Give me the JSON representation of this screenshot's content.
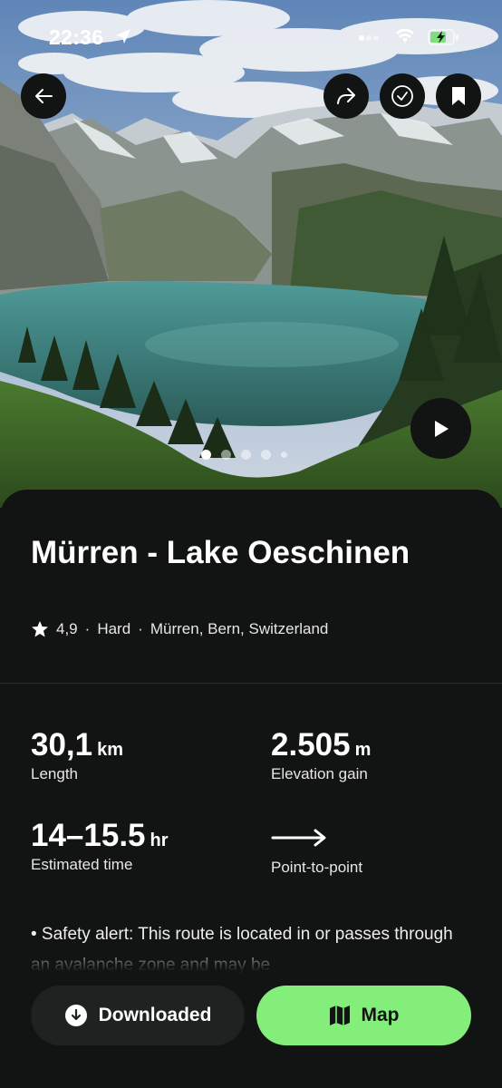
{
  "status_bar": {
    "time": "22:36",
    "icons": [
      "location-arrow-icon",
      "cellular-icon",
      "wifi-icon",
      "battery-charging-icon"
    ]
  },
  "hero": {
    "image": "mountain-lake-photo",
    "pages": 5,
    "active_page": 1,
    "actions": [
      "back-icon",
      "share-icon",
      "check-icon",
      "bookmark-icon",
      "play-icon"
    ]
  },
  "trail": {
    "title": "Mürren - Lake Oeschinen",
    "rating": "4,9",
    "difficulty": "Hard",
    "location": "Mürren, Bern, Switzerland",
    "separator": "·"
  },
  "stats": {
    "length": {
      "value": "30,1",
      "unit": "km",
      "label": "Length"
    },
    "elevation": {
      "value": "2.505",
      "unit": "m",
      "label": "Elevation gain"
    },
    "time": {
      "value": "14–15.5",
      "unit": "hr",
      "label": "Estimated time"
    },
    "route": {
      "label": "Point-to-point",
      "icon": "arrow-right-icon"
    }
  },
  "alert": {
    "text": "• Safety alert: This route is located in or passes through an avalanche zone and may be"
  },
  "actions": {
    "downloaded_label": "Downloaded",
    "map_label": "Map"
  },
  "colors": {
    "background": "#121413",
    "accent": "#84ee7b",
    "secondary_button": "#1e2220"
  }
}
